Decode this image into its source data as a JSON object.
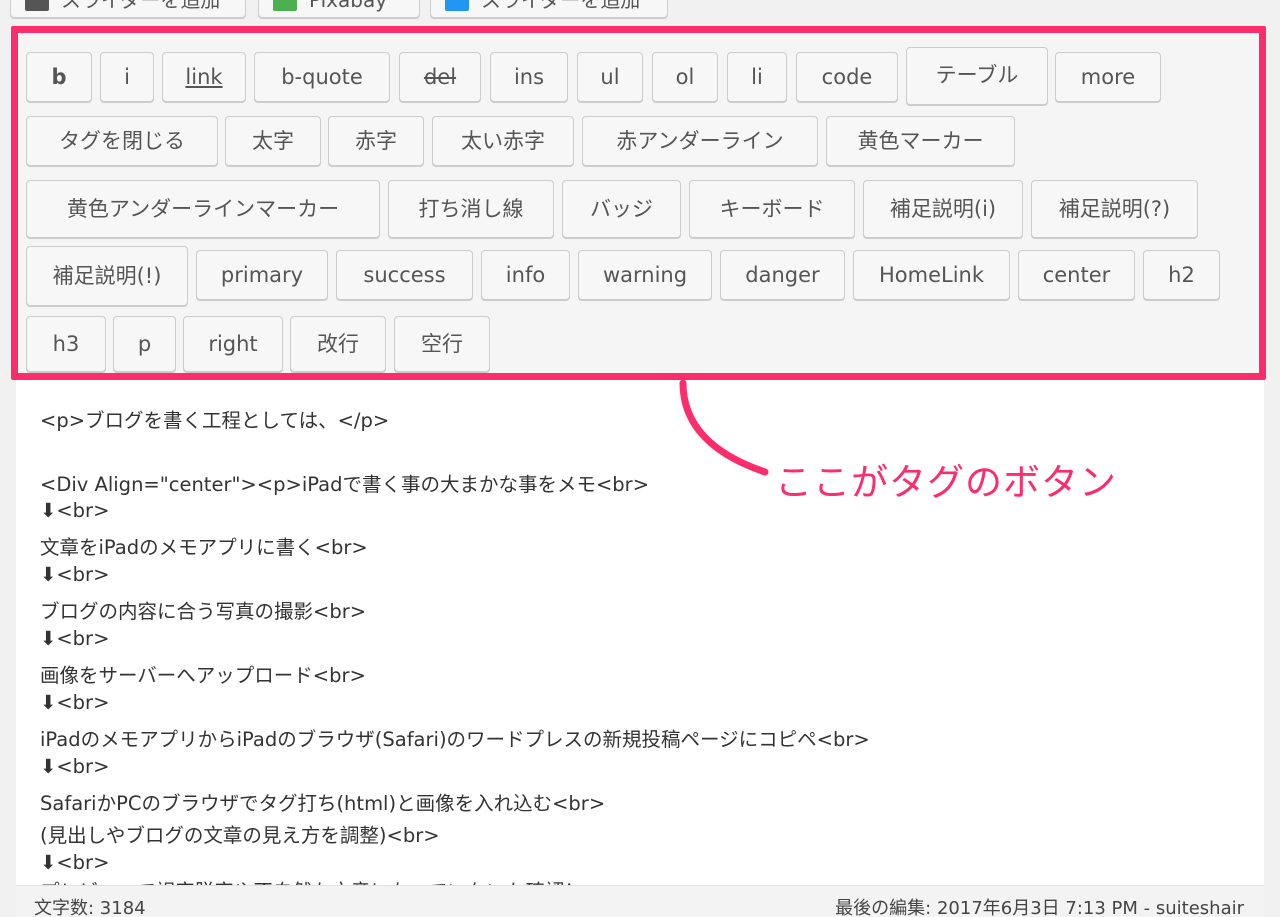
{
  "media_buttons": [
    {
      "label": "スライダーを追加",
      "icon": "slider-icon"
    },
    {
      "label": "Pixabay",
      "icon": "image-icon"
    },
    {
      "label": "スライダーを追加",
      "icon": "slider-icon-alt"
    }
  ],
  "toolbar": {
    "rows": [
      [
        "b",
        "i",
        "link",
        "b-quote",
        "del",
        "ins",
        "ul",
        "ol",
        "li",
        "code",
        "テーブル",
        "more"
      ],
      [
        "タグを閉じる",
        "太字",
        "赤字",
        "太い赤字",
        "赤アンダーライン",
        "黄色マーカー"
      ],
      [
        "黄色アンダーラインマーカー",
        "打ち消し線",
        "バッジ",
        "キーボード",
        "補足説明(i)",
        "補足説明(?)"
      ],
      [
        "補足説明(!)",
        "primary",
        "success",
        "info",
        "warning",
        "danger",
        "HomeLink",
        "center",
        "h2"
      ],
      [
        "h3",
        "p",
        "right",
        "改行",
        "空行"
      ]
    ]
  },
  "editor": {
    "lines": [
      "<p>ブログを書く工程としては、</p>",
      "",
      "<Div Align=\"center\"><p>iPadで書く事の大まかな事をメモ<br>",
      "⬇<br>",
      "文章をiPadのメモアプリに書く<br>",
      "⬇<br>",
      "ブログの内容に合う写真の撮影<br>",
      "⬇<br>",
      "画像をサーバーへアップロード<br>",
      "⬇<br>",
      "iPadのメモアプリからiPadのブラウザ(Safari)のワードプレスの新規投稿ページにコピペ<br>",
      "⬇<br>",
      "SafariかPCのブラウザでタグ打ち(html)と画像を入れ込む<br>",
      "(見出しやブログの文章の見え方を調整)<br>",
      "⬇<br>",
      "プレビューで誤字脱字や不自然な文章になっていないか確認！"
    ]
  },
  "annotation": {
    "text": "ここがタグのボタン",
    "color": "#fb2d6c"
  },
  "status": {
    "word_count": "文字数: 3184",
    "last_edit": "最後の編集: 2017年6月3日 7:13 PM - suiteshair"
  }
}
